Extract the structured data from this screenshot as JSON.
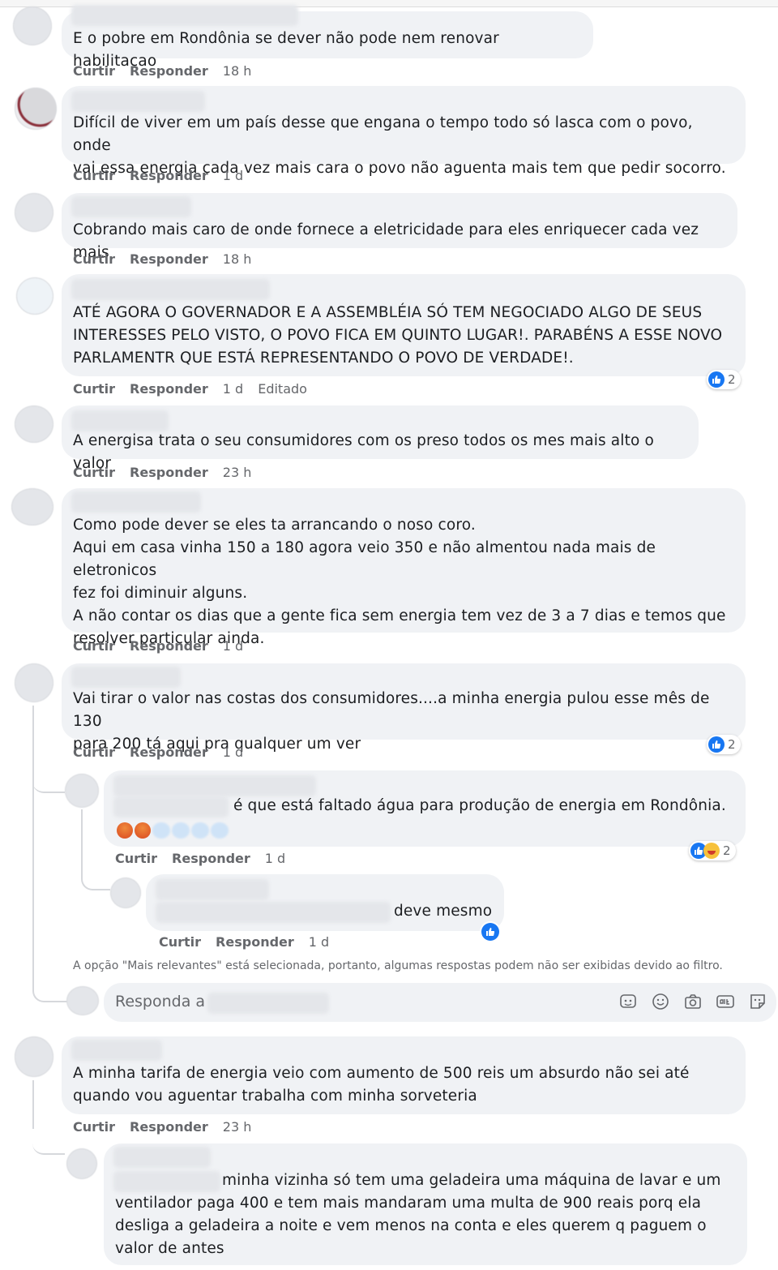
{
  "actions": {
    "like_label": "Curtir",
    "reply_label": "Responder",
    "edited_label": "Editado"
  },
  "comments": [
    {
      "text": "E o pobre em Rondônia se dever não pode nem renovar habilitacao",
      "time": "18 h"
    },
    {
      "text": "Difícil de viver em um país desse que engana o tempo todo só lasca com o povo, onde\nvai essa energia cada vez mais cara o povo não aguenta mais tem que pedir socorro.",
      "time": "1 d"
    },
    {
      "text": "Cobrando mais caro de onde fornece a eletricidade para eles enriquecer cada vez mais",
      "time": "18 h"
    },
    {
      "text": "ATÉ AGORA O GOVERNADOR E A ASSEMBLÉIA SÓ TEM NEGOCIADO ALGO DE SEUS\nINTERESSES PELO VISTO, O POVO FICA EM QUINTO LUGAR!. PARABÉNS A ESSE NOVO\nPARLAMENTR QUE ESTÁ REPRESENTANDO O POVO DE VERDADE!.",
      "time": "1 d",
      "reactions": "2"
    },
    {
      "text": "A energisa trata o seu consumidores com os preso todos os mes mais alto o valor",
      "time": "23 h"
    },
    {
      "text": "Como pode dever se eles ta arrancando o noso coro.\nAqui em casa vinha 150 a 180 agora veio 350 e não almentou nada mais de eletronicos\nfez foi diminuir alguns.\nA não contar os dias que a gente fica sem energia tem vez de 3 a 7 dias e temos que\nresolver particular ainda.",
      "time": "1 d"
    },
    {
      "text": "Vai tirar o valor nas costas dos consumidores....a minha energia pulou esse mês de 130\npara 200 tá aqui pra qualquer um ver",
      "time": "1 d",
      "reactions": "2"
    },
    {
      "text": "A minha tarifa de energia veio com aumento de 500 reis um absurdo não sei até\nquando vou aguentar trabalha com minha sorveteria",
      "time": "23 h"
    }
  ],
  "replies": [
    {
      "text": "é que está faltado água para produção de energia em Rondônia.",
      "time": "1 d",
      "reactions": "2"
    },
    {
      "text": "deve mesmo",
      "time": "1 d"
    },
    {
      "text": "minha vizinha só tem uma geladeira uma máquina de lavar e um\nventilador paga 400 e tem mais mandaram uma multa de 900 reais porq ela\ndesliga a geladeira a noite e vem menos na conta e eles querem q paguem o\nvalor de antes"
    }
  ],
  "filter_note": "A opção \"Mais relevantes\" está selecionada, portanto, algumas respostas podem não ser exibidas devido ao filtro.",
  "reply_box": {
    "placeholder": "Responda a"
  },
  "icons": [
    "like-icon",
    "haha-icon",
    "angry-icon",
    "gif-icon",
    "emoji-icon",
    "camera-icon",
    "sticker-icon",
    "avatar-sticker-icon"
  ],
  "colors": {
    "bubble": "#f0f2f5",
    "like_blue": "#1877f2",
    "meta_gray": "#65676b"
  }
}
